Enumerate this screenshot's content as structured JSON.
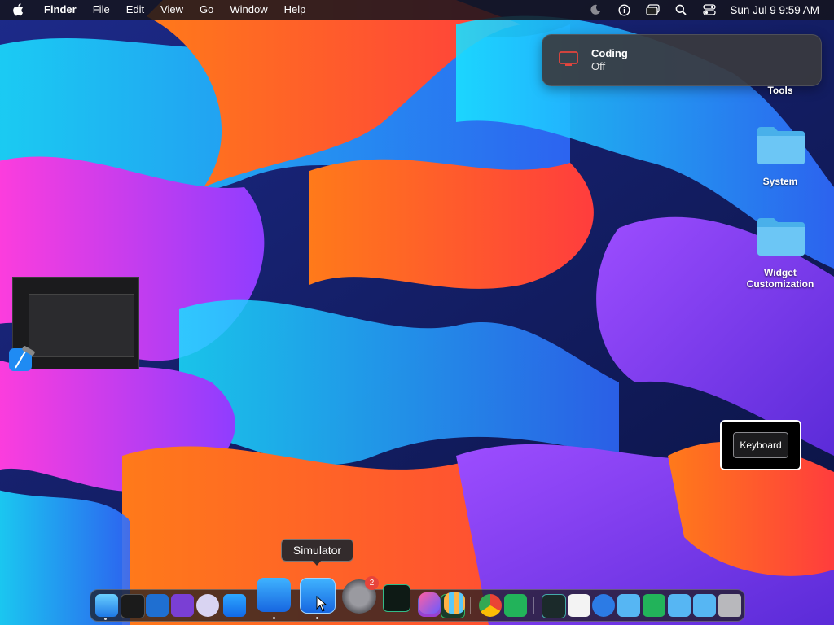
{
  "menubar": {
    "app_name": "Finder",
    "menus": [
      "File",
      "Edit",
      "View",
      "Go",
      "Window",
      "Help"
    ],
    "status_icons": [
      "moon-icon",
      "info-icon",
      "window-icon",
      "search-icon",
      "control-center-icon"
    ],
    "clock": "Sun Jul 9  9:59 AM"
  },
  "notification": {
    "icon": "display-icon",
    "title": "Coding",
    "subtitle": "Off",
    "icon_color": "#e5453d"
  },
  "desktop_icons": [
    {
      "label": "Tools"
    },
    {
      "label": "System"
    },
    {
      "label": "Widget Customization"
    }
  ],
  "keyboard_panel": {
    "button_label": "Keyboard"
  },
  "dock": {
    "tooltip": "Simulator",
    "badge_count": "2",
    "items": [
      "finder-icon",
      "terminal-icon",
      "vscode-icon",
      "visual-studio-icon",
      "bbedit-icon",
      "app-store-icon",
      "xcode-icon",
      "simulator-icon",
      "system-settings-icon",
      "activity-monitor-icon",
      "shortcuts-icon",
      "launchpad-icon",
      "chrome-icon",
      "app-green-icon",
      "screen-icon",
      "document-icon",
      "safari-icon",
      "folder-icon",
      "app-green-icon",
      "folder-icon",
      "folder-icon",
      "trash-icon"
    ]
  }
}
